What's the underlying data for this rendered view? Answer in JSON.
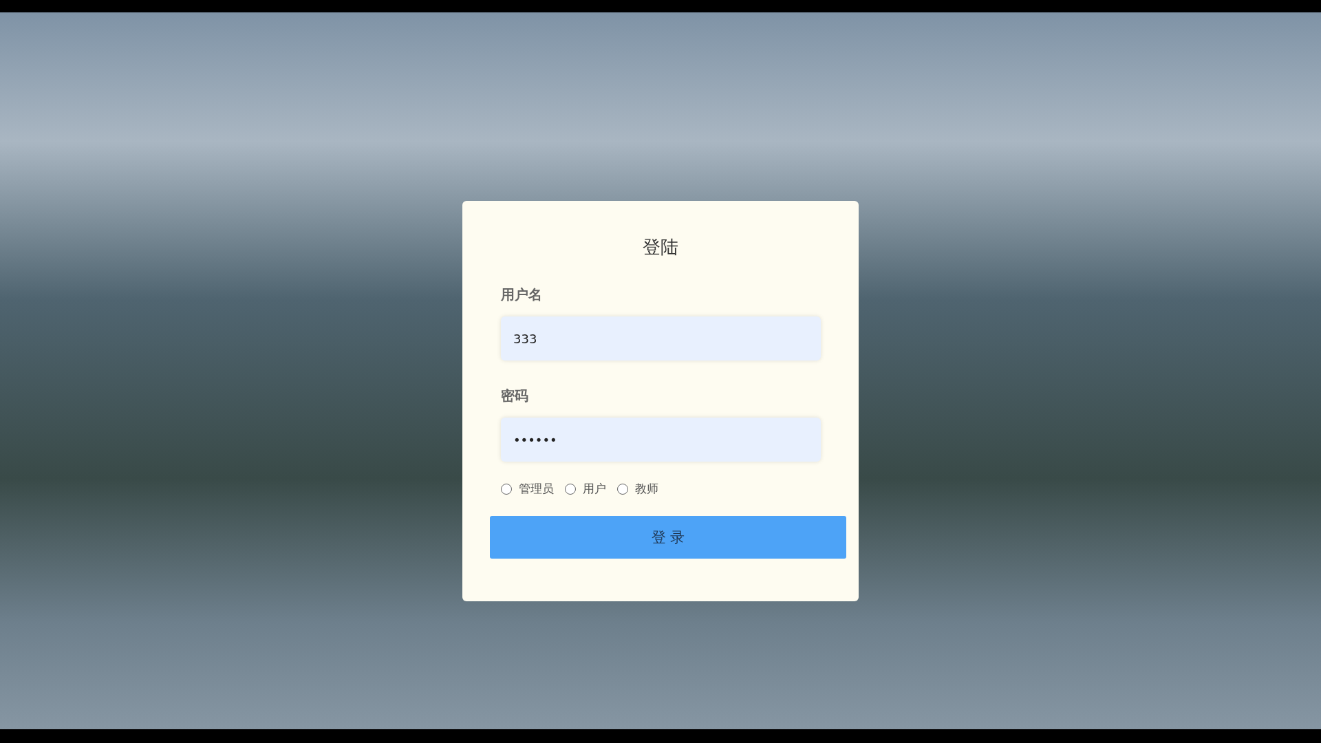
{
  "login_card": {
    "title": "登陆",
    "fields": [
      {
        "label": "用户名",
        "value": "333"
      },
      {
        "label": "密码",
        "value": "••••••"
      }
    ],
    "roles": [
      {
        "label": "管理员",
        "selected": false
      },
      {
        "label": "用户",
        "selected": false
      },
      {
        "label": "教师",
        "selected": false
      }
    ],
    "submit_button": "登 录"
  }
}
